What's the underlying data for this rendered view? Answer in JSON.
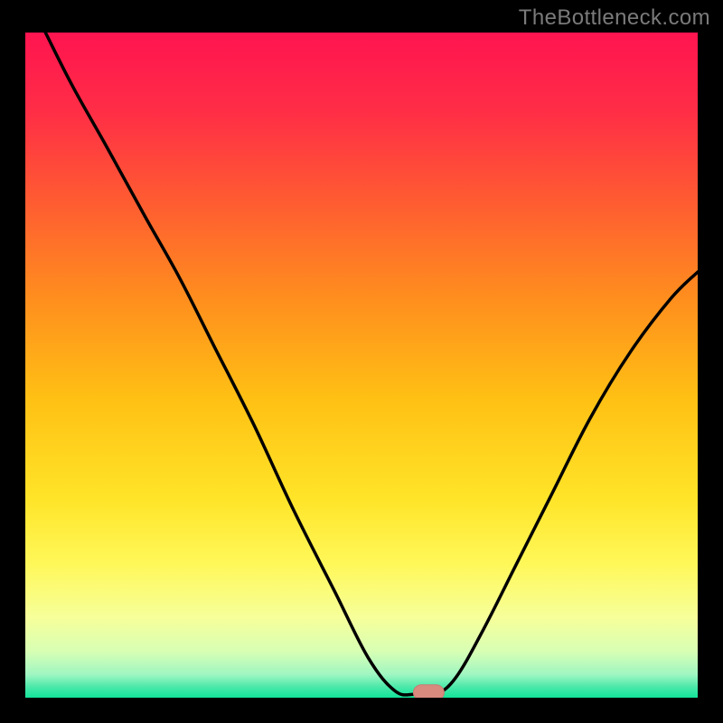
{
  "watermark": "TheBottleneck.com",
  "colors": {
    "bg": "#000000",
    "curve": "#000000",
    "marker_fill": "#d88a7f",
    "marker_stroke": "#c97a71",
    "grad_stops": [
      {
        "offset": 0.0,
        "color": "#ff1450"
      },
      {
        "offset": 0.12,
        "color": "#ff2e46"
      },
      {
        "offset": 0.25,
        "color": "#ff5a32"
      },
      {
        "offset": 0.4,
        "color": "#ff8e1e"
      },
      {
        "offset": 0.55,
        "color": "#ffc014"
      },
      {
        "offset": 0.7,
        "color": "#ffe428"
      },
      {
        "offset": 0.8,
        "color": "#fff85a"
      },
      {
        "offset": 0.88,
        "color": "#f6ff9a"
      },
      {
        "offset": 0.93,
        "color": "#d8ffb4"
      },
      {
        "offset": 0.965,
        "color": "#a0f6c2"
      },
      {
        "offset": 0.985,
        "color": "#46e8a8"
      },
      {
        "offset": 1.0,
        "color": "#12e49a"
      }
    ]
  },
  "chart_data": {
    "type": "line",
    "title": "",
    "xlabel": "",
    "ylabel": "",
    "x_range": [
      0,
      100
    ],
    "y_range": [
      0,
      100
    ],
    "curve": [
      {
        "x": 3,
        "y": 100
      },
      {
        "x": 7,
        "y": 92
      },
      {
        "x": 12,
        "y": 83
      },
      {
        "x": 18,
        "y": 72
      },
      {
        "x": 23,
        "y": 63
      },
      {
        "x": 28,
        "y": 53
      },
      {
        "x": 34,
        "y": 41
      },
      {
        "x": 40,
        "y": 28
      },
      {
        "x": 46,
        "y": 16
      },
      {
        "x": 51,
        "y": 6
      },
      {
        "x": 55,
        "y": 1
      },
      {
        "x": 58,
        "y": 0.5
      },
      {
        "x": 61,
        "y": 0.5
      },
      {
        "x": 64,
        "y": 3
      },
      {
        "x": 68,
        "y": 10
      },
      {
        "x": 73,
        "y": 20
      },
      {
        "x": 78,
        "y": 30
      },
      {
        "x": 84,
        "y": 42
      },
      {
        "x": 90,
        "y": 52
      },
      {
        "x": 96,
        "y": 60
      },
      {
        "x": 100,
        "y": 64
      }
    ],
    "marker": {
      "x": 60,
      "y": 0.5
    },
    "annotations": []
  }
}
